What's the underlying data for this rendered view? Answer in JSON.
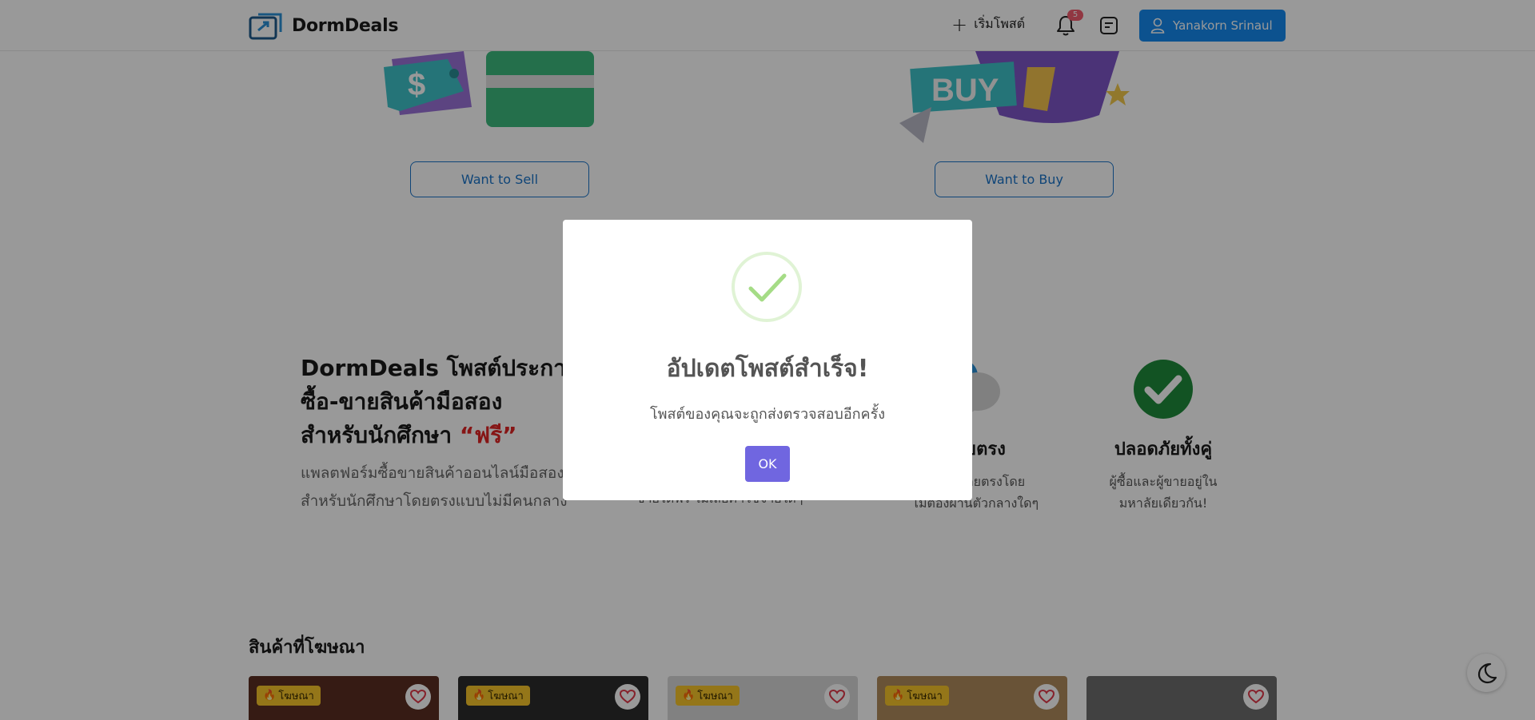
{
  "header": {
    "brand": "DormDeals",
    "new_post_label": "เริ่มโพสต์",
    "notification_count": "5",
    "user_name": "Yanakorn Srinaul"
  },
  "hero": {
    "sell_label": "Want to Sell",
    "buy_label": "Want to Buy",
    "buy_sign": "BUY"
  },
  "features": {
    "title_line1": "DormDeals โพสต์ประกาศ",
    "title_line2": "ซื้อ-ขายสินค้ามือสอง",
    "title_line3_prefix": "สำหรับนักศึกษา ",
    "title_free": "“ฟรี”",
    "subtitle_line1": "แพลตฟอร์มซื้อขายสินค้าออนไลน์มือสอง",
    "subtitle_line2": "สำหรับนักศึกษาโดยตรงแบบไม่มีคนกลาง",
    "col_free_desc": "ขายได้ฟรี ไม่เสียค่าใช้จ่ายใดๆ",
    "col_direct_head": "โดยตรง",
    "col_direct_desc1": "คุยกันโดยตรงโดย",
    "col_direct_desc2": "ไม่ต้องผ่านตัวกลางใดๆ",
    "col_safe_head": "ปลอดภัยทั้งคู่",
    "col_safe_desc1": "ผู้ซื้อและผู้ขายอยู่ใน",
    "col_safe_desc2": "มหาลัยเดียวกัน!"
  },
  "ads": {
    "title": "สินค้าที่โฆษณา",
    "badge_label": "โฆษณา",
    "cards": [
      {
        "badge": "โฆษณา",
        "color": "#5a2e22"
      },
      {
        "badge": "โฆษณา",
        "color": "#2c2c2c"
      },
      {
        "badge": "โฆษณา",
        "color": "#d8d8d8"
      },
      {
        "badge": "โฆษณา",
        "color": "#b08a5c"
      },
      {
        "badge": "",
        "color": "#6d6d6d"
      }
    ]
  },
  "modal": {
    "title": "อัปเดตโพสต์สำเร็จ!",
    "text": "โพสต์ของคุณจะถูกส่งตรวจสอบอีกครั้ง",
    "ok_label": "OK"
  },
  "colors": {
    "primary": "#1589ee",
    "confirm": "#7066e0",
    "success": "#a5dc86",
    "free_red": "#e02424",
    "overlay": "rgba(0,0,0,0.4)"
  },
  "icons": [
    "logo-icon",
    "plus-icon",
    "bell-icon",
    "chat-icon",
    "user-icon",
    "check-icon",
    "heart-icon",
    "fire-icon",
    "moon-icon"
  ]
}
